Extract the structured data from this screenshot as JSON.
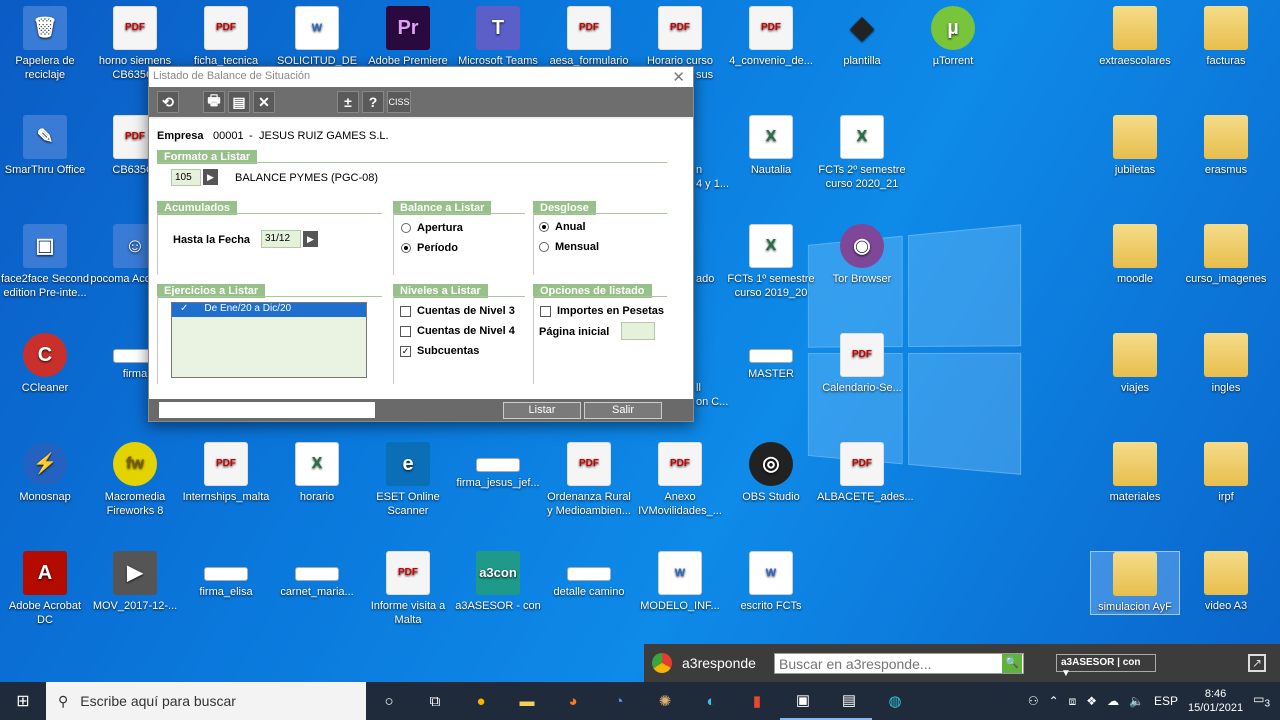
{
  "desktop": {
    "icons": [
      {
        "id": "papelera",
        "label": "Papelera de reciclaje",
        "glyph": "🗑",
        "kind": "sys"
      },
      {
        "id": "horno",
        "label": "horno siemens CB635GI",
        "glyph": "PDF",
        "kind": "pdf"
      },
      {
        "id": "ficha",
        "label": "ficha_tecnica",
        "glyph": "PDF",
        "kind": "pdf"
      },
      {
        "id": "solicitud",
        "label": "SOLICITUD_DE",
        "glyph": "W",
        "kind": "doc"
      },
      {
        "id": "premiere",
        "label": "Adobe Premiere",
        "glyph": "Pr",
        "kind": "pr"
      },
      {
        "id": "teams",
        "label": "Microsoft Teams",
        "glyph": "T",
        "kind": "teams"
      },
      {
        "id": "aesa",
        "label": "aesa_formulario",
        "glyph": "PDF",
        "kind": "pdf"
      },
      {
        "id": "horario_curso",
        "label": "Horario curso",
        "glyph": "PDF",
        "kind": "pdf"
      },
      {
        "id": "convenio",
        "label": "4_convenio_de...",
        "glyph": "PDF",
        "kind": "pdf"
      },
      {
        "id": "plantilla",
        "label": "plantilla",
        "glyph": "◆",
        "kind": "ink"
      },
      {
        "id": "utorrent",
        "label": "µTorrent",
        "glyph": "µ",
        "kind": "ut"
      },
      {
        "id": "extraescolares",
        "label": "extraescolares",
        "glyph": "",
        "kind": "folder"
      },
      {
        "id": "facturas",
        "label": "facturas",
        "glyph": "",
        "kind": "folder"
      },
      {
        "id": "smarthru",
        "label": "SmarThru Office",
        "glyph": "✎",
        "kind": "sys"
      },
      {
        "id": "cb635",
        "label": "CB635GI",
        "glyph": "PDF",
        "kind": "pdf"
      },
      {
        "id": "nautalia",
        "label": "Nautalia",
        "glyph": "X",
        "kind": "xls"
      },
      {
        "id": "fcts2",
        "label": "FCTs 2º semestre curso 2020_21",
        "glyph": "X",
        "kind": "xls"
      },
      {
        "id": "jubiletas",
        "label": "jubiletas",
        "glyph": "",
        "kind": "folder"
      },
      {
        "id": "erasmus",
        "label": "erasmus",
        "glyph": "",
        "kind": "folder"
      },
      {
        "id": "face2face",
        "label": "face2face Second edition Pre-inte...",
        "glyph": "▣",
        "kind": "sys"
      },
      {
        "id": "pocoma",
        "label": "pocoma Acceso di",
        "glyph": "☺",
        "kind": "sys"
      },
      {
        "id": "fcts1",
        "label": "FCTs 1º semestre curso 2019_20",
        "glyph": "X",
        "kind": "xls"
      },
      {
        "id": "tor",
        "label": "Tor Browser",
        "glyph": "◉",
        "kind": "tor"
      },
      {
        "id": "moodle",
        "label": "moodle",
        "glyph": "",
        "kind": "folder"
      },
      {
        "id": "curso_imagenes",
        "label": "curso_imagenes",
        "glyph": "",
        "kind": "folder"
      },
      {
        "id": "ccleaner",
        "label": "CCleaner",
        "glyph": "C",
        "kind": "cc"
      },
      {
        "id": "firma",
        "label": "firma",
        "glyph": "",
        "kind": "img"
      },
      {
        "id": "master",
        "label": "MASTER",
        "glyph": "",
        "kind": "img"
      },
      {
        "id": "calendario",
        "label": "Calendario-Se...",
        "glyph": "PDF",
        "kind": "pdf"
      },
      {
        "id": "viajes",
        "label": "viajes",
        "glyph": "",
        "kind": "folder"
      },
      {
        "id": "ingles",
        "label": "ingles",
        "glyph": "",
        "kind": "folder"
      },
      {
        "id": "monosnap",
        "label": "Monosnap",
        "glyph": "⚡",
        "kind": "mono"
      },
      {
        "id": "fireworks",
        "label": "Macromedia Fireworks 8",
        "glyph": "fw",
        "kind": "fw"
      },
      {
        "id": "internships",
        "label": "Internships_malta",
        "glyph": "PDF",
        "kind": "pdf"
      },
      {
        "id": "horario",
        "label": "horario",
        "glyph": "X",
        "kind": "xls"
      },
      {
        "id": "eset",
        "label": "ESET Online Scanner",
        "glyph": "e",
        "kind": "eset"
      },
      {
        "id": "firma_jesus",
        "label": "firma_jesus_jef...",
        "glyph": "",
        "kind": "img"
      },
      {
        "id": "ordenanza",
        "label": "Ordenanza Rural y Medioambien...",
        "glyph": "PDF",
        "kind": "pdf"
      },
      {
        "id": "anexo",
        "label": "Anexo IVMovilidades_...",
        "glyph": "PDF",
        "kind": "pdf"
      },
      {
        "id": "obs",
        "label": "OBS Studio",
        "glyph": "◎",
        "kind": "obs"
      },
      {
        "id": "albacete",
        "label": "ALBACETE_ades...",
        "glyph": "PDF",
        "kind": "pdf"
      },
      {
        "id": "materiales",
        "label": "materiales",
        "glyph": "",
        "kind": "folder"
      },
      {
        "id": "irpf",
        "label": "irpf",
        "glyph": "",
        "kind": "folder"
      },
      {
        "id": "acrobat",
        "label": "Adobe Acrobat DC",
        "glyph": "A",
        "kind": "acro"
      },
      {
        "id": "mov",
        "label": "MOV_2017-12-...",
        "glyph": "▶",
        "kind": "vid"
      },
      {
        "id": "firma_elisa",
        "label": "firma_elisa",
        "glyph": "",
        "kind": "img"
      },
      {
        "id": "carnet",
        "label": "carnet_maria...",
        "glyph": "",
        "kind": "img"
      },
      {
        "id": "informe",
        "label": "Informe visita a Malta",
        "glyph": "PDF",
        "kind": "pdf"
      },
      {
        "id": "a3asesor",
        "label": "a3ASESOR - con",
        "glyph": "a3con",
        "kind": "a3"
      },
      {
        "id": "detalle",
        "label": "detalle camino",
        "glyph": "",
        "kind": "img"
      },
      {
        "id": "modelo",
        "label": "MODELO_INF...",
        "glyph": "W",
        "kind": "doc"
      },
      {
        "id": "escrito",
        "label": "escrito FCTs",
        "glyph": "W",
        "kind": "doc"
      },
      {
        "id": "simulacion",
        "label": "simulacion AyF",
        "glyph": "",
        "kind": "folder"
      },
      {
        "id": "video_a3",
        "label": "video A3",
        "glyph": "",
        "kind": "folder"
      }
    ],
    "partial_labels": {
      "p1": "sus",
      "p2": "n",
      "p3": "4 y 1...",
      "p4": "ado",
      "p5": "ll",
      "p6": "on C..."
    }
  },
  "dialog": {
    "title": "Listado de Balance de Situación",
    "toolbar": [
      "⟲",
      "🖶",
      "▤",
      "✕",
      "±",
      "?",
      "CISS"
    ],
    "empresa_label": "Empresa",
    "empresa_code": "00001",
    "empresa_sep": "-",
    "empresa_name": "JESUS RUIZ GAMES S.L.",
    "formato_tab": "Formato a Listar",
    "formato_code": "105",
    "formato_name": "BALANCE PYMES (PGC-08)",
    "acumulados_tab": "Acumulados",
    "hasta_label": "Hasta la Fecha",
    "hasta_value": "31/12",
    "balance_tab": "Balance a Listar",
    "apertura": "Apertura",
    "periodo": "Período",
    "desglose_tab": "Desglose",
    "anual": "Anual",
    "mensual": "Mensual",
    "ejercicios_tab": "Ejercicios a Listar",
    "ejercicio_check": "✓",
    "ejercicio_item": "De Ene/20 a Dic/20",
    "niveles_tab": "Niveles a Listar",
    "nivel3": "Cuentas de Nivel 3",
    "nivel4": "Cuentas de Nivel 4",
    "subcuentas": "Subcuentas",
    "opciones_tab": "Opciones de listado",
    "pesetas": "Importes en Pesetas",
    "pagina_label": "Página inicial",
    "pagina_value": "",
    "listar": "Listar",
    "salir": "Salir",
    "close": "✕"
  },
  "a3bar": {
    "brand": "a3responde",
    "placeholder": "Buscar en a3responde...",
    "con_label": "a3ASESOR | con ▼"
  },
  "taskbar": {
    "search": "Escribe aquí para buscar",
    "lang": "ESP",
    "time": "8:46",
    "date": "15/01/2021",
    "notif": "3"
  }
}
